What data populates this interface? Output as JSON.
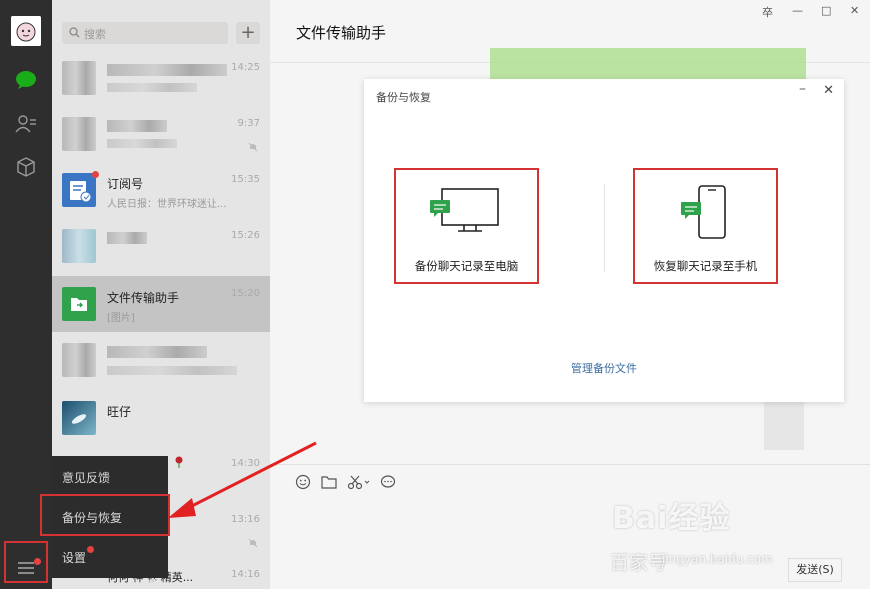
{
  "search": {
    "placeholder": "搜索"
  },
  "chats": [
    {
      "name": "",
      "preview": "",
      "time": "14:25",
      "blurred": true
    },
    {
      "name": "",
      "preview": "",
      "time": "9:37",
      "blurred": true,
      "muted": true
    },
    {
      "name": "订阅号",
      "preview": "人民日报：世界环球迷让...",
      "time": "15:35",
      "unread_dot": true
    },
    {
      "name": "",
      "preview": "",
      "time": "15:26",
      "blurred": true
    },
    {
      "name": "文件传输助手",
      "preview": "[图片]",
      "time": "15:20",
      "selected": true
    },
    {
      "name": "",
      "preview": "",
      "time": "",
      "blurred": true
    },
    {
      "name": "旺仔",
      "preview": "",
      "time": ""
    },
    {
      "name": "",
      "preview": "",
      "time": "14:30"
    },
    {
      "name": "",
      "preview": "",
      "time": "13:16",
      "muted": true
    },
    {
      "name": "何何·神🐄 精英...",
      "preview": "",
      "time": "14:16"
    }
  ],
  "main": {
    "title": "文件传输助手",
    "send_label": "发送(S)"
  },
  "window_controls": {
    "pin": "卒",
    "minimize": "—",
    "maximize": "□",
    "close": "✕"
  },
  "dialog": {
    "title": "备份与恢复",
    "minimize": "–",
    "close": "✕",
    "backup_label": "备份聊天记录至电脑",
    "restore_label": "恢复聊天记录至手机",
    "manage_label": "管理备份文件"
  },
  "menu": {
    "feedback": "意见反馈",
    "backup": "备份与恢复",
    "settings": "设置"
  },
  "watermark": {
    "brand": "Bai经验",
    "subtitle": "百家号",
    "url": "jingyan.baidu.com"
  },
  "colors": {
    "wechat_green": "#1aad19",
    "highlight_red": "#d43333",
    "rail_bg": "#2e2e2e"
  }
}
